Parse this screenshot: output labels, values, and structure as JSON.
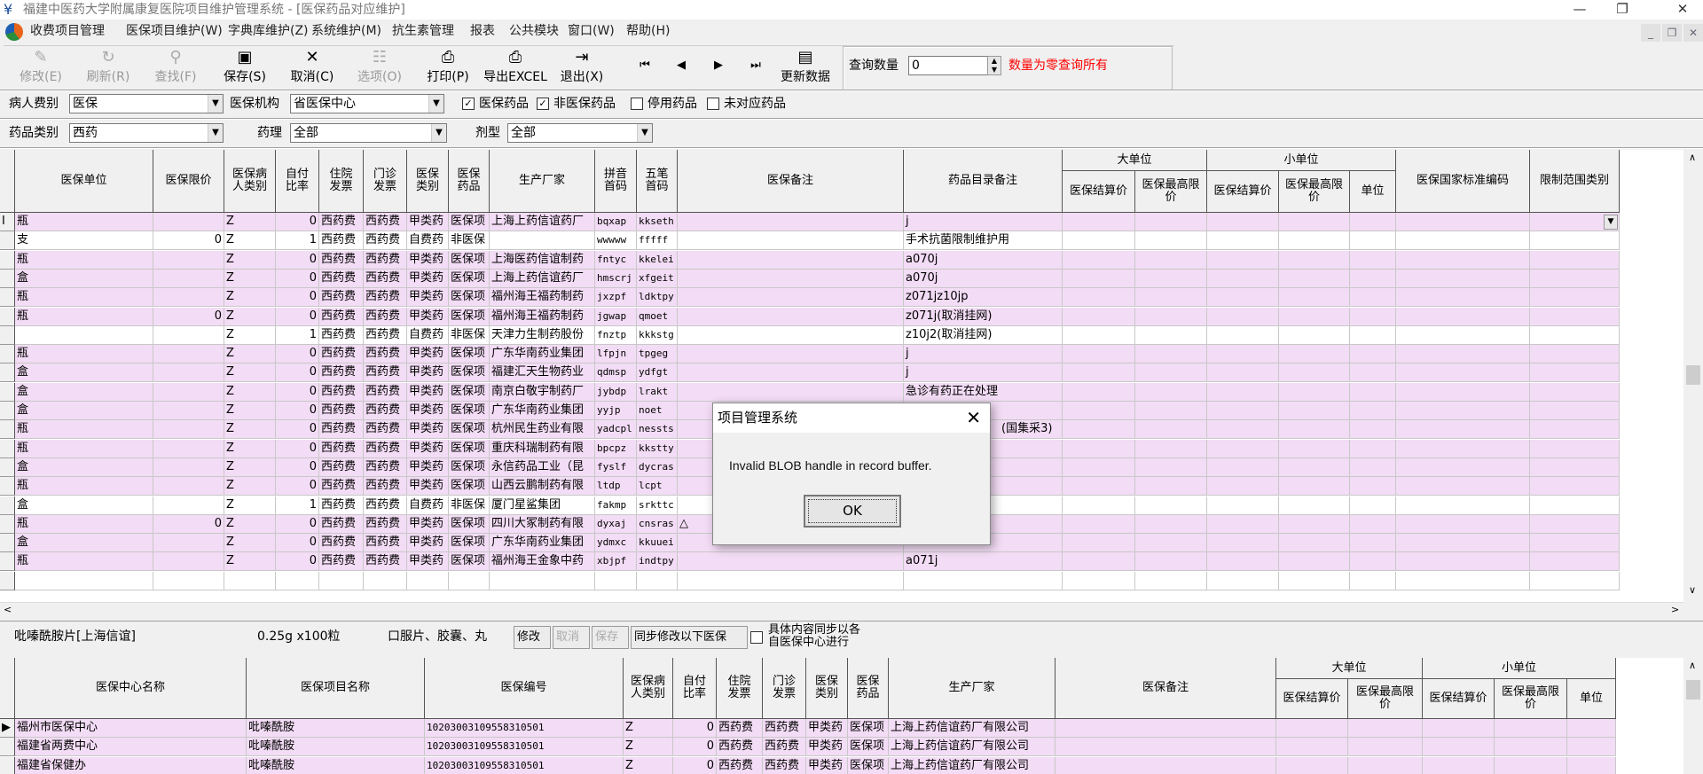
{
  "window": {
    "title": "福建中医药大学附属康复医院项目维护管理系统 - [医保药品对应维护]"
  },
  "menu": [
    "收费项目管理",
    "医保项目维护(W)",
    "字典库维护(Z)",
    "系统维护(M)",
    "抗生素管理",
    "报表",
    "公共模块",
    "窗口(W)",
    "帮助(H)"
  ],
  "toolbar": {
    "buttons": [
      {
        "label": "修改(E)",
        "icon": "edit-icon",
        "enabled": false
      },
      {
        "label": "刷新(R)",
        "icon": "refresh-icon",
        "enabled": false
      },
      {
        "label": "查找(F)",
        "icon": "binoculars-icon",
        "enabled": false
      },
      {
        "label": "保存(S)",
        "icon": "save-icon",
        "enabled": true
      },
      {
        "label": "取消(C)",
        "icon": "cancel-icon",
        "enabled": true
      },
      {
        "label": "选项(O)",
        "icon": "options-icon",
        "enabled": false
      },
      {
        "label": "打印(P)",
        "icon": "print-icon",
        "enabled": true
      },
      {
        "label": "导出EXCEL",
        "icon": "export-icon",
        "enabled": true
      },
      {
        "label": "退出(X)",
        "icon": "exit-icon",
        "enabled": true
      }
    ],
    "nav": [
      "first-record-icon",
      "prev-record-icon",
      "next-record-icon",
      "last-record-icon"
    ],
    "update_label": "更新数据",
    "query_label": "查询数量",
    "query_value": "0",
    "query_hint": "数量为零查询所有",
    "hint_color": "#ff0000"
  },
  "filters": {
    "patient_type_label": "病人费别",
    "patient_type": "医保",
    "org_label": "医保机构",
    "org": "省医保中心",
    "checks": [
      {
        "label": "医保药品",
        "checked": true
      },
      {
        "label": "非医保药品",
        "checked": true
      },
      {
        "label": "停用药品",
        "checked": false
      },
      {
        "label": "未对应药品",
        "checked": false
      }
    ],
    "drug_class_label": "药品类别",
    "drug_class": "西药",
    "pharm_label": "药理",
    "pharm": "全部",
    "form_label": "剂型",
    "form": "全部"
  },
  "main_grid": {
    "headers": [
      "医保单位",
      "医保限价",
      "医保病\n人类别",
      "自付\n比率",
      "住院\n发票",
      "门诊\n发票",
      "医保\n类别",
      "医保\n药品",
      "生产厂家",
      "拼音\n首码",
      "五笔\n首码",
      "医保备注",
      "药品目录备注",
      "医保结算价",
      "医保最高限\n价",
      "医保结算价",
      "医保最高限\n价",
      "单位",
      "医保国家标准编码",
      "限制范围类别"
    ],
    "groups": [
      "大单位",
      "小单位"
    ],
    "row_color": "#f3dcf5",
    "rows": [
      {
        "pink": true,
        "v": [
          "瓶",
          "",
          "Z",
          "0",
          "西药费",
          "西药费",
          "甲类药",
          "医保项",
          "上海上药信谊药厂",
          "bqxap",
          "kkseth",
          "",
          "j"
        ]
      },
      {
        "pink": false,
        "v": [
          "支",
          "0",
          "Z",
          "1",
          "西药费",
          "西药费",
          "自费药",
          "非医保",
          "",
          "wwwww",
          "fffff",
          "",
          "手术抗菌限制维护用"
        ]
      },
      {
        "pink": true,
        "v": [
          "瓶",
          "",
          "Z",
          "0",
          "西药费",
          "西药费",
          "甲类药",
          "医保项",
          "上海医药信谊制药",
          "fntyc",
          "kkelei",
          "",
          "a070j"
        ]
      },
      {
        "pink": true,
        "v": [
          "盒",
          "",
          "Z",
          "0",
          "西药费",
          "西药费",
          "甲类药",
          "医保项",
          "上海上药信谊药厂",
          "hmscrj",
          "xfgeit",
          "",
          "a070j"
        ]
      },
      {
        "pink": true,
        "v": [
          "瓶",
          "",
          "Z",
          "0",
          "西药费",
          "西药费",
          "甲类药",
          "医保项",
          "福州海王福药制药",
          "jxzpf",
          "ldktpy",
          "",
          "z071jz10jp"
        ]
      },
      {
        "pink": true,
        "v": [
          "瓶",
          "0",
          "Z",
          "0",
          "西药费",
          "西药费",
          "甲类药",
          "医保项",
          "福州海王福药制药",
          "jgwap",
          "qmoet",
          "",
          "z071j(取消挂网)"
        ]
      },
      {
        "pink": false,
        "v": [
          "",
          "",
          "Z",
          "1",
          "西药费",
          "西药费",
          "自费药",
          "非医保",
          "天津力生制药股份",
          "fnztp",
          "kkkstg",
          "",
          "z10j2(取消挂网)"
        ]
      },
      {
        "pink": true,
        "v": [
          "瓶",
          "",
          "Z",
          "0",
          "西药费",
          "西药费",
          "甲类药",
          "医保项",
          "广东华南药业集团",
          "lfpjn",
          "tpgeg",
          "",
          "j"
        ]
      },
      {
        "pink": true,
        "v": [
          "盒",
          "",
          "Z",
          "0",
          "西药费",
          "西药费",
          "甲类药",
          "医保项",
          "福建汇天生物药业",
          "qdmsp",
          "ydfgt",
          "",
          "j"
        ]
      },
      {
        "pink": true,
        "v": [
          "盒",
          "",
          "Z",
          "0",
          "西药费",
          "西药费",
          "甲类药",
          "医保项",
          "南京白敬宇制药厂",
          "jybdp",
          "lrakt",
          "",
          "急诊有药正在处理"
        ]
      },
      {
        "pink": true,
        "v": [
          "盒",
          "",
          "Z",
          "0",
          "西药费",
          "西药费",
          "甲类药",
          "医保项",
          "广东华南药业集团",
          "yyjp",
          "noet",
          "",
          ""
        ]
      },
      {
        "pink": true,
        "v": [
          "瓶",
          "",
          "Z",
          "0",
          "西药费",
          "西药费",
          "甲类药",
          "医保项",
          "杭州民生药业有限",
          "yadcpl",
          "nessts",
          "",
          "(国集采3)"
        ]
      },
      {
        "pink": true,
        "v": [
          "瓶",
          "",
          "Z",
          "0",
          "西药费",
          "西药费",
          "甲类药",
          "医保项",
          "重庆科瑞制药有限",
          "bpcpz",
          "kkstty",
          "",
          ""
        ]
      },
      {
        "pink": true,
        "v": [
          "盒",
          "",
          "Z",
          "0",
          "西药费",
          "西药费",
          "甲类药",
          "医保项",
          "永信药品工业（昆",
          "fyslf",
          "dycras",
          "",
          ""
        ]
      },
      {
        "pink": true,
        "v": [
          "瓶",
          "",
          "Z",
          "0",
          "西药费",
          "西药费",
          "甲类药",
          "医保项",
          "山西云鹏制药有限",
          "ltdp",
          "lcpt",
          "",
          ""
        ]
      },
      {
        "pink": false,
        "v": [
          "盒",
          "",
          "Z",
          "1",
          "西药费",
          "西药费",
          "自费药",
          "非医保",
          "厦门星鲨集团",
          "fakmp",
          "srkttc",
          "",
          ""
        ]
      },
      {
        "pink": true,
        "v": [
          "瓶",
          "0",
          "Z",
          "0",
          "西药费",
          "西药费",
          "甲类药",
          "医保项",
          "四川大冢制药有限",
          "dyxaj",
          "cnsras",
          "△",
          ""
        ]
      },
      {
        "pink": true,
        "v": [
          "盒",
          "",
          "Z",
          "0",
          "西药费",
          "西药费",
          "甲类药",
          "医保项",
          "广东华南药业集团",
          "ydmxc",
          "kkuuei",
          "",
          ""
        ]
      },
      {
        "pink": true,
        "v": [
          "瓶",
          "",
          "Z",
          "0",
          "西药费",
          "西药费",
          "甲类药",
          "医保项",
          "福州海王金象中药",
          "xbjpf",
          "indtpy",
          "",
          "a071j"
        ]
      }
    ]
  },
  "detail": {
    "name": "吡嗪酰胺片[上海信谊]",
    "spec": "0.25g x100粒",
    "form": "口服片、胶囊、丸",
    "btn_edit": "修改",
    "btn_cancel": "取消",
    "btn_save": "保存",
    "btn_sync": "同步修改以下医保",
    "sync_check": false,
    "sync_label": "具体内容同步以各\n自医保中心进行"
  },
  "sub_grid": {
    "headers": [
      "医保中心名称",
      "医保项目名称",
      "医保编号",
      "医保病\n人类别",
      "自付\n比率",
      "住院\n发票",
      "门诊\n发票",
      "医保\n类别",
      "医保\n药品",
      "生产厂家",
      "医保备注",
      "医保结算价",
      "医保最高限\n价",
      "医保结算价",
      "医保最高限\n价",
      "单位"
    ],
    "groups": [
      "大单位",
      "小单位"
    ],
    "rows": [
      [
        "福州市医保中心",
        "吡嗪酰胺",
        "10203003109558310501",
        "Z",
        "0",
        "西药费",
        "西药费",
        "甲类药",
        "医保项",
        "上海上药信谊药厂有限公司"
      ],
      [
        "福建省两费中心",
        "吡嗪酰胺",
        "10203003109558310501",
        "Z",
        "0",
        "西药费",
        "西药费",
        "甲类药",
        "医保项",
        "上海上药信谊药厂有限公司"
      ],
      [
        "福建省保健办",
        "吡嗪酰胺",
        "10203003109558310501",
        "Z",
        "0",
        "西药费",
        "西药费",
        "甲类药",
        "医保项",
        "上海上药信谊药厂有限公司"
      ]
    ]
  },
  "dialog": {
    "title": "项目管理系统",
    "message": "Invalid BLOB handle in record buffer.",
    "ok": "OK"
  }
}
